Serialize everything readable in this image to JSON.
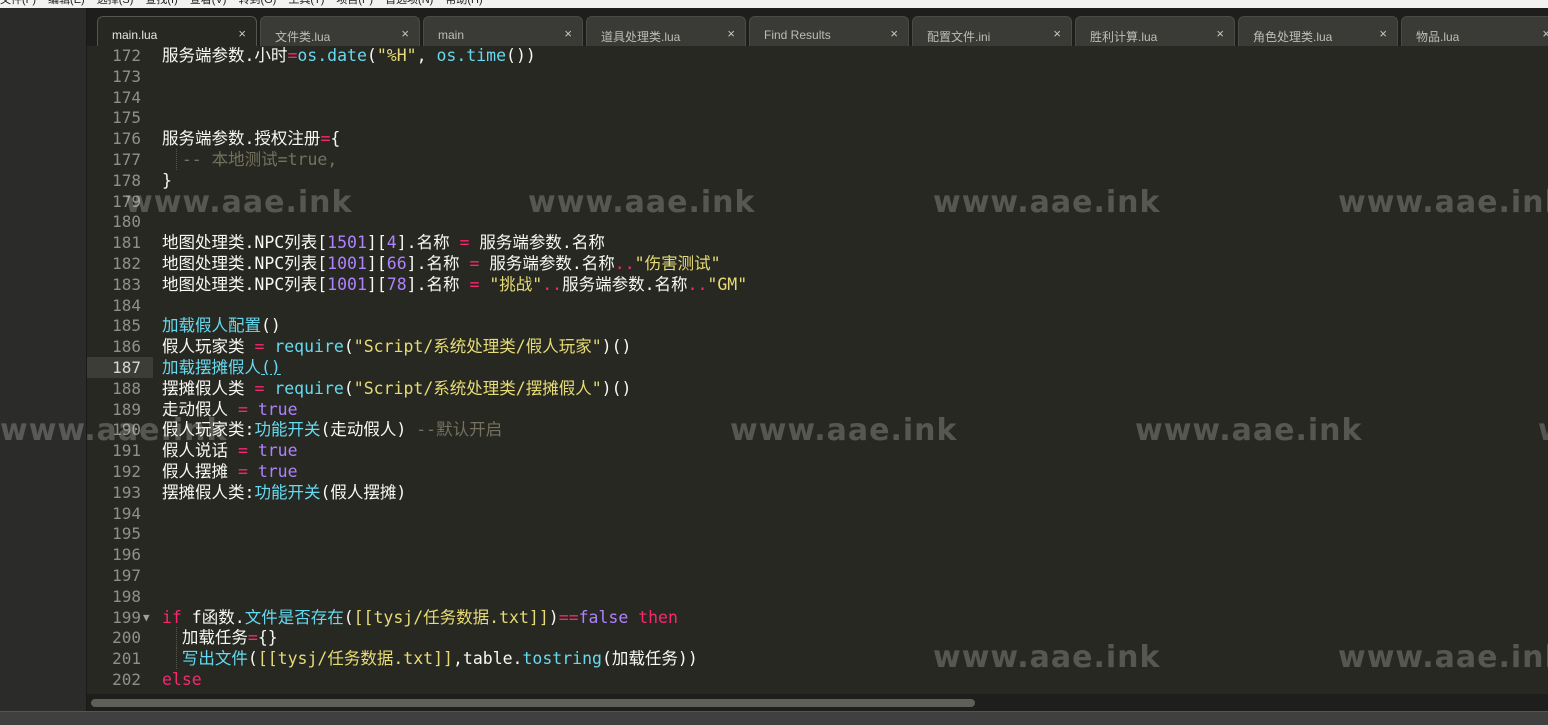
{
  "menubar": {
    "items": [
      "文件(F)",
      "编辑(E)",
      "选择(S)",
      "查找(I)",
      "查看(V)",
      "转到(G)",
      "工具(T)",
      "项目(P)",
      "首选项(N)",
      "帮助(H)"
    ]
  },
  "tabs": [
    {
      "label": "main.lua",
      "active": true
    },
    {
      "label": "文件类.lua",
      "active": false
    },
    {
      "label": "main",
      "active": false
    },
    {
      "label": "道具处理类.lua",
      "active": false
    },
    {
      "label": "Find Results",
      "active": false
    },
    {
      "label": "配置文件.ini",
      "active": false
    },
    {
      "label": "胜利计算.lua",
      "active": false
    },
    {
      "label": "角色处理类.lua",
      "active": false
    },
    {
      "label": "物品.lua",
      "active": false
    }
  ],
  "tab_close_glyph": "×",
  "watermark": "www.aae.ink",
  "current_line": 187,
  "lines": [
    {
      "num": "172",
      "tokens": [
        [
          "w",
          "服务端参数.小时"
        ],
        [
          "op",
          "="
        ],
        [
          "fn",
          "os.date"
        ],
        [
          "w",
          "("
        ],
        [
          "str",
          "\"%H\""
        ],
        [
          "w",
          ", "
        ],
        [
          "fn",
          "os.time"
        ],
        [
          "w",
          "())"
        ]
      ]
    },
    {
      "num": "173",
      "tokens": []
    },
    {
      "num": "174",
      "tokens": []
    },
    {
      "num": "175",
      "tokens": []
    },
    {
      "num": "176",
      "tokens": [
        [
          "w",
          "服务端参数.授权注册"
        ],
        [
          "op",
          "="
        ],
        [
          "w",
          "{"
        ]
      ]
    },
    {
      "num": "177",
      "tokens": [
        [
          "cm",
          "  -- 本地测试=true,"
        ]
      ]
    },
    {
      "num": "178",
      "tokens": [
        [
          "w",
          "}"
        ]
      ]
    },
    {
      "num": "179",
      "tokens": []
    },
    {
      "num": "180",
      "tokens": []
    },
    {
      "num": "181",
      "tokens": [
        [
          "w",
          "地图处理类.NPC列表["
        ],
        [
          "num",
          "1501"
        ],
        [
          "w",
          "]["
        ],
        [
          "num",
          "4"
        ],
        [
          "w",
          "].名称 "
        ],
        [
          "op",
          "="
        ],
        [
          "w",
          " 服务端参数.名称"
        ]
      ]
    },
    {
      "num": "182",
      "tokens": [
        [
          "w",
          "地图处理类.NPC列表["
        ],
        [
          "num",
          "1001"
        ],
        [
          "w",
          "]["
        ],
        [
          "num",
          "66"
        ],
        [
          "w",
          "].名称 "
        ],
        [
          "op",
          "="
        ],
        [
          "w",
          " 服务端参数.名称"
        ],
        [
          "op",
          ".."
        ],
        [
          "str",
          "\"伤害测试\""
        ]
      ]
    },
    {
      "num": "183",
      "tokens": [
        [
          "w",
          "地图处理类.NPC列表["
        ],
        [
          "num",
          "1001"
        ],
        [
          "w",
          "]["
        ],
        [
          "num",
          "78"
        ],
        [
          "w",
          "].名称 "
        ],
        [
          "op",
          "="
        ],
        [
          "w",
          " "
        ],
        [
          "str",
          "\"挑战\""
        ],
        [
          "op",
          ".."
        ],
        [
          "w",
          "服务端参数.名称"
        ],
        [
          "op",
          ".."
        ],
        [
          "str",
          "\"GM\""
        ]
      ]
    },
    {
      "num": "184",
      "tokens": []
    },
    {
      "num": "185",
      "tokens": [
        [
          "fn",
          "加载假人配置"
        ],
        [
          "w",
          "()"
        ]
      ]
    },
    {
      "num": "186",
      "tokens": [
        [
          "w",
          "假人玩家类 "
        ],
        [
          "op",
          "="
        ],
        [
          "w",
          " "
        ],
        [
          "fn",
          "require"
        ],
        [
          "w",
          "("
        ],
        [
          "str",
          "\"Script/系统处理类/假人玩家\""
        ],
        [
          "w",
          ")()"
        ]
      ]
    },
    {
      "num": "187",
      "tokens": [
        [
          "fn",
          "加载摆摊假人"
        ],
        [
          "curl",
          "()"
        ]
      ]
    },
    {
      "num": "188",
      "tokens": [
        [
          "w",
          "摆摊假人类 "
        ],
        [
          "op",
          "="
        ],
        [
          "w",
          " "
        ],
        [
          "fn",
          "require"
        ],
        [
          "w",
          "("
        ],
        [
          "str",
          "\"Script/系统处理类/摆摊假人\""
        ],
        [
          "w",
          ")()"
        ]
      ]
    },
    {
      "num": "189",
      "tokens": [
        [
          "w",
          "走动假人 "
        ],
        [
          "op",
          "="
        ],
        [
          "w",
          " "
        ],
        [
          "const",
          "true"
        ]
      ]
    },
    {
      "num": "190",
      "tokens": [
        [
          "w",
          "假人玩家类:"
        ],
        [
          "fn",
          "功能开关"
        ],
        [
          "w",
          "(走动假人) "
        ],
        [
          "cm",
          "--默认开启"
        ]
      ]
    },
    {
      "num": "191",
      "tokens": [
        [
          "w",
          "假人说话 "
        ],
        [
          "op",
          "="
        ],
        [
          "w",
          " "
        ],
        [
          "const",
          "true"
        ]
      ]
    },
    {
      "num": "192",
      "tokens": [
        [
          "w",
          "假人摆摊 "
        ],
        [
          "op",
          "="
        ],
        [
          "w",
          " "
        ],
        [
          "const",
          "true"
        ]
      ]
    },
    {
      "num": "193",
      "tokens": [
        [
          "w",
          "摆摊假人类:"
        ],
        [
          "fn",
          "功能开关"
        ],
        [
          "w",
          "(假人摆摊)"
        ]
      ]
    },
    {
      "num": "194",
      "tokens": []
    },
    {
      "num": "195",
      "tokens": []
    },
    {
      "num": "196",
      "tokens": []
    },
    {
      "num": "197",
      "tokens": []
    },
    {
      "num": "198",
      "tokens": []
    },
    {
      "num": "199",
      "fold": "▼",
      "tokens": [
        [
          "kw",
          "if"
        ],
        [
          "w",
          " f函数."
        ],
        [
          "fn",
          "文件是否存在"
        ],
        [
          "w",
          "("
        ],
        [
          "str",
          "[[tysj/任务数据.txt]]"
        ],
        [
          "w",
          ")"
        ],
        [
          "op",
          "=="
        ],
        [
          "const",
          "false"
        ],
        [
          "w",
          " "
        ],
        [
          "kw",
          "then"
        ]
      ]
    },
    {
      "num": "200",
      "tokens": [
        [
          "w",
          "  加载任务"
        ],
        [
          "op",
          "="
        ],
        [
          "w",
          "{}"
        ]
      ]
    },
    {
      "num": "201",
      "tokens": [
        [
          "w",
          "  "
        ],
        [
          "fn",
          "写出文件"
        ],
        [
          "w",
          "("
        ],
        [
          "str",
          "[[tysj/任务数据.txt]]"
        ],
        [
          "w",
          ",table."
        ],
        [
          "fn",
          "tostring"
        ],
        [
          "w",
          "(加载任务))"
        ]
      ]
    },
    {
      "num": "202",
      "tokens": [
        [
          "kw",
          "else"
        ]
      ]
    }
  ]
}
